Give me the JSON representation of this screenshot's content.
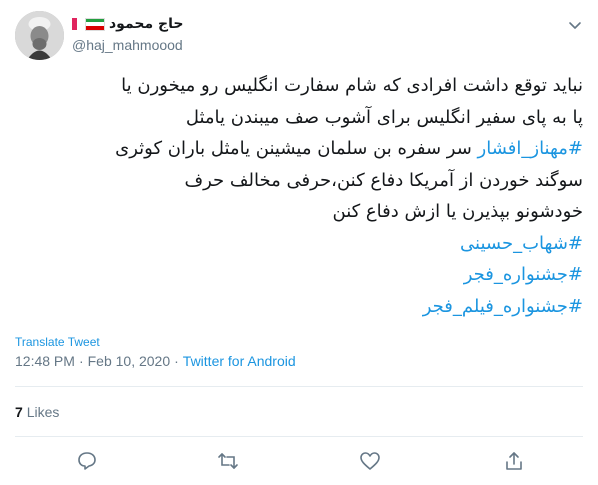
{
  "user": {
    "display_name": "حاج محمود",
    "handle": "@haj_mahmoood"
  },
  "tweet": {
    "lines": [
      [
        {
          "t": "نباید توقع داشت افرادی که شام سفارت انگلیس رو میخورن یا",
          "h": false
        }
      ],
      [
        {
          "t": "پا به پای سفیر انگلیس برای آشوب صف میبندن یامثل",
          "h": false
        }
      ],
      [
        {
          "t": "#مهناز_افشار",
          "h": true
        },
        {
          "t": " سر سفره بن سلمان میشینن یامثل باران کوثری",
          "h": false
        }
      ],
      [
        {
          "t": "سوگند خوردن از آمریکا دفاع کنن،حرفی مخالف حرف",
          "h": false
        }
      ],
      [
        {
          "t": "خودشونو بپذیرن یا ازش دفاع کنن",
          "h": false
        }
      ],
      [
        {
          "t": "#شهاب_حسینی",
          "h": true
        }
      ],
      [
        {
          "t": "#جشنواره_فجر",
          "h": true
        }
      ],
      [
        {
          "t": "#جشنواره_فیلم_فجر",
          "h": true
        }
      ]
    ],
    "translate_label": "Translate Tweet",
    "time": "12:48 PM",
    "separator": "·",
    "date": "Feb 10, 2020",
    "source": "Twitter for Android",
    "likes_count": "7",
    "likes_label": "Likes"
  },
  "icons": {
    "reply": "reply-icon",
    "retweet": "retweet-icon",
    "like": "heart-icon",
    "share": "share-icon",
    "caret": "chevron-down-icon"
  },
  "colors": {
    "link": "#1b95e0",
    "muted": "#657786",
    "text": "#14171a",
    "divider": "#e6ecf0"
  }
}
